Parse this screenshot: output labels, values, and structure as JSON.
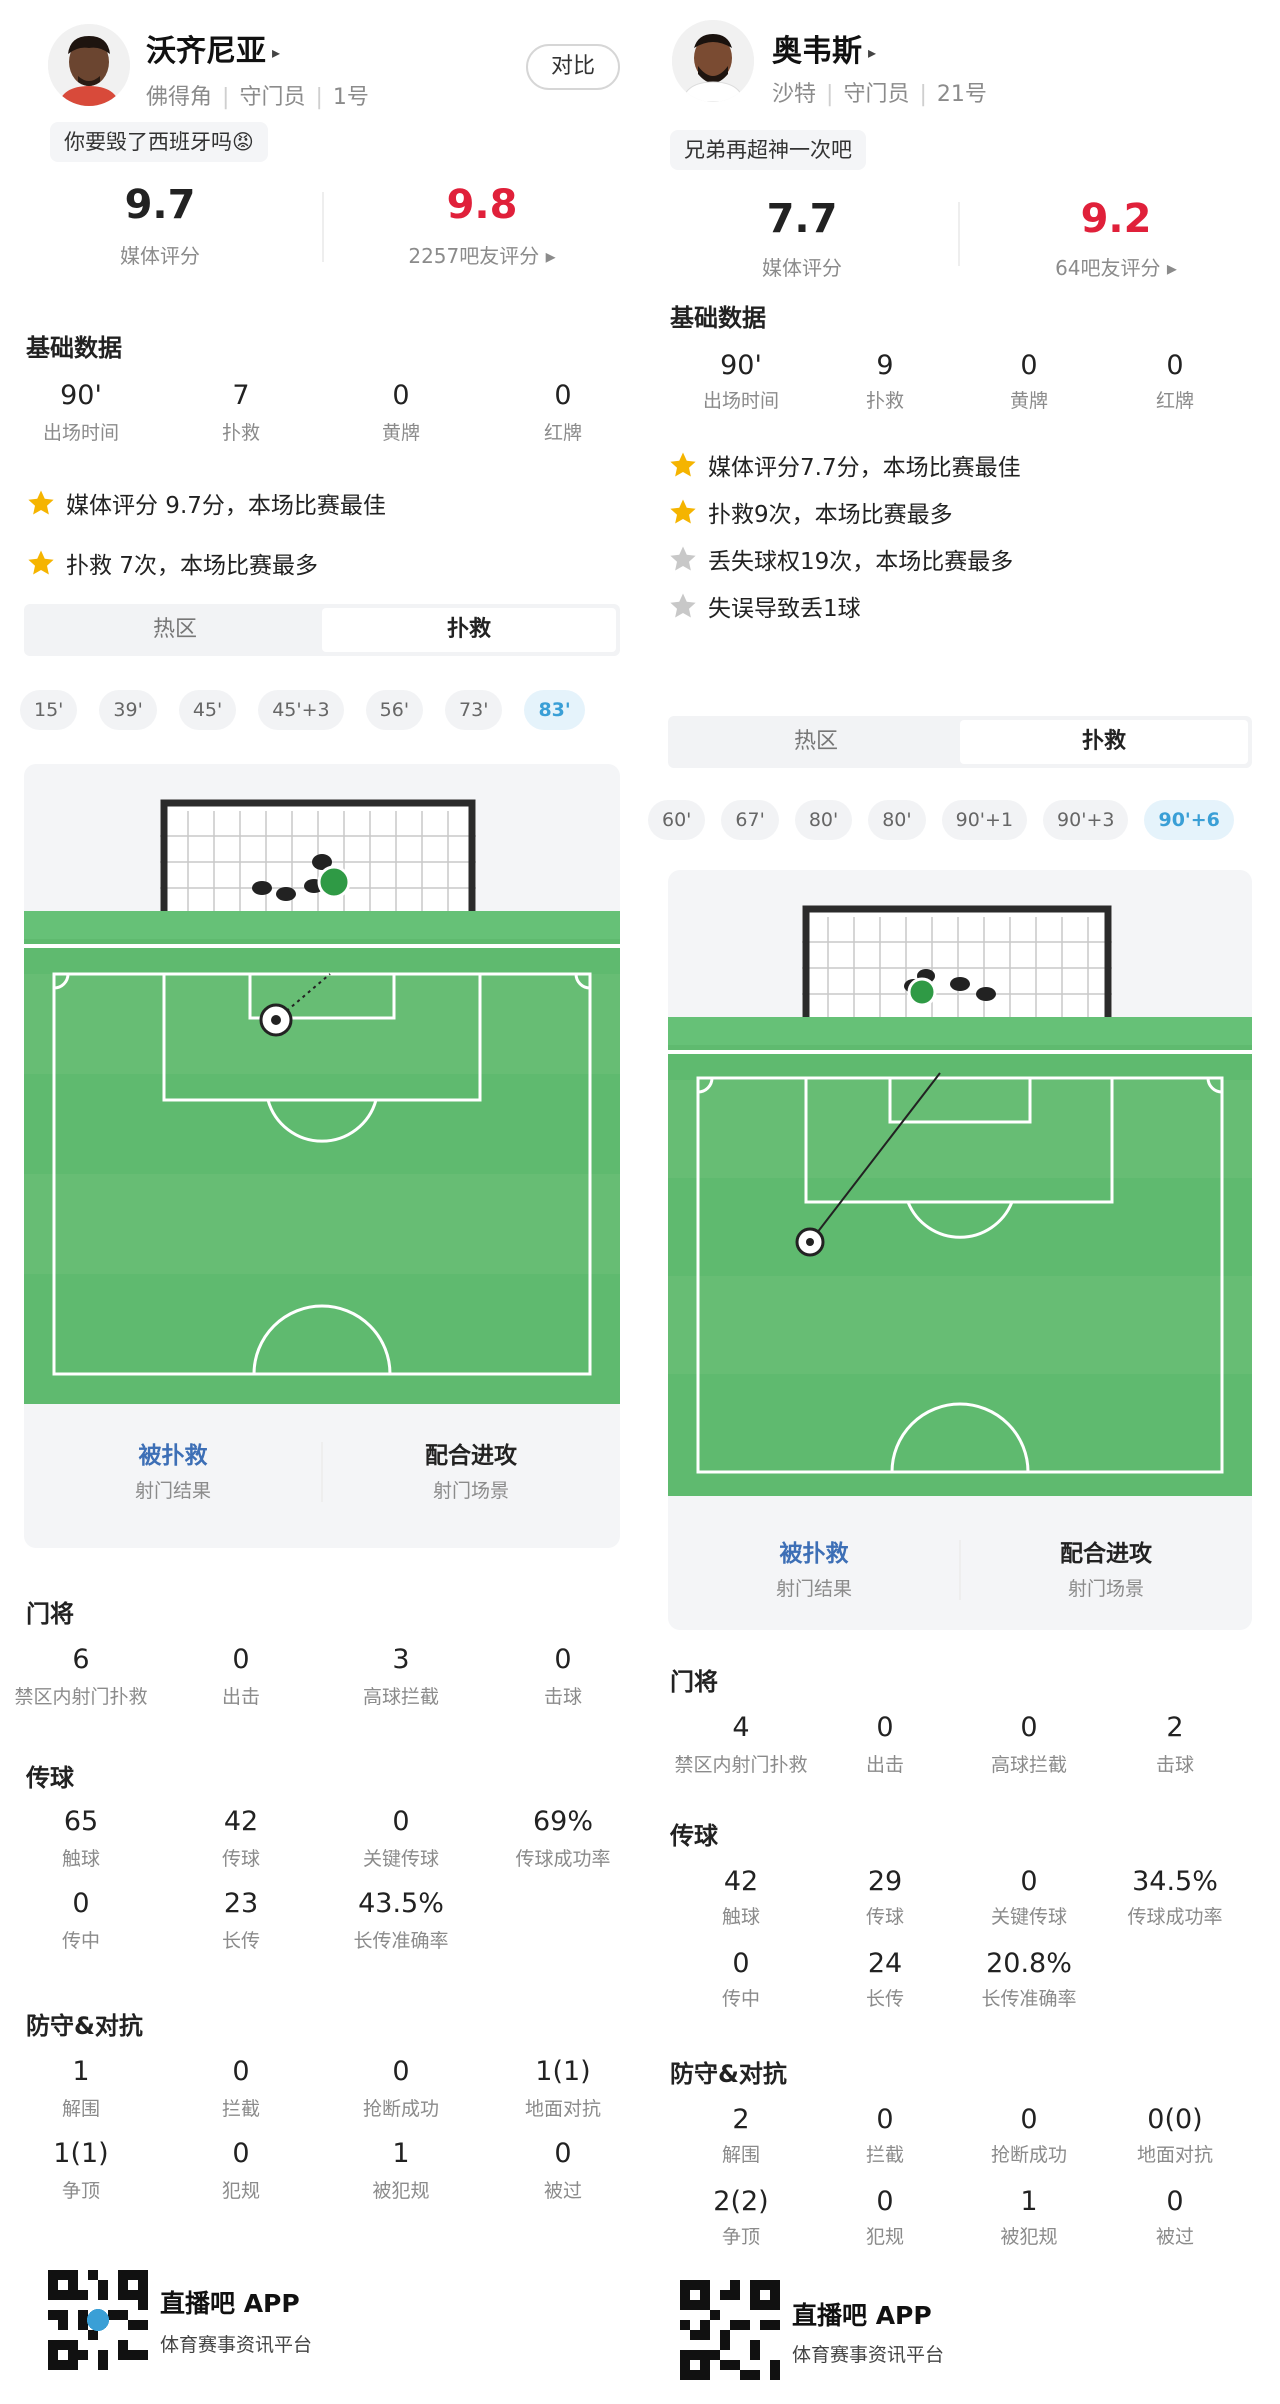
{
  "colors": {
    "rating_fan": "#e0203a",
    "accent_blue": "#3a9fd6",
    "result_blue": "#3d6fb6",
    "pitch_green": "#5fba6f",
    "star_gold": "#f5b400",
    "star_grey": "#c8c8c8"
  },
  "left": {
    "player": {
      "name": "沃齐尼亚",
      "team": "佛得角",
      "position": "守门员",
      "number": "1号",
      "quote": "你要毁了西班牙吗😡",
      "compare_label": "对比"
    },
    "ratings": {
      "media_value": "9.7",
      "media_label": "媒体评分",
      "fan_value": "9.8",
      "fan_label": "2257吧友评分 ▸"
    },
    "basic": {
      "title": "基础数据",
      "items": [
        {
          "value": "90'",
          "label": "出场时间"
        },
        {
          "value": "7",
          "label": "扑救"
        },
        {
          "value": "0",
          "label": "黄牌"
        },
        {
          "value": "0",
          "label": "红牌"
        }
      ]
    },
    "highlights": [
      {
        "text": "媒体评分 9.7分，本场比赛最佳",
        "icon": "star-gold-icon"
      },
      {
        "text": "扑救 7次，本场比赛最多",
        "icon": "star-gold-icon"
      }
    ],
    "tabs": [
      "热区",
      "扑救"
    ],
    "active_tab": 1,
    "chips": [
      "15'",
      "39'",
      "45'",
      "45'+3",
      "56'",
      "73'",
      "83'"
    ],
    "active_chip": 6,
    "shot": {
      "result_value": "被扑救",
      "result_label": "射门结果",
      "scene_value": "配合进攻",
      "scene_label": "射门场景"
    },
    "gk": {
      "title": "门将",
      "items": [
        {
          "value": "6",
          "label": "禁区内射门扑救"
        },
        {
          "value": "0",
          "label": "出击"
        },
        {
          "value": "3",
          "label": "高球拦截"
        },
        {
          "value": "0",
          "label": "击球"
        }
      ]
    },
    "passing": {
      "title": "传球",
      "row1": [
        {
          "value": "65",
          "label": "触球"
        },
        {
          "value": "42",
          "label": "传球"
        },
        {
          "value": "0",
          "label": "关键传球"
        },
        {
          "value": "69%",
          "label": "传球成功率"
        }
      ],
      "row2": [
        {
          "value": "0",
          "label": "传中"
        },
        {
          "value": "23",
          "label": "长传"
        },
        {
          "value": "43.5%",
          "label": "长传准确率"
        }
      ]
    },
    "defense": {
      "title": "防守&对抗",
      "row1": [
        {
          "value": "1",
          "label": "解围"
        },
        {
          "value": "0",
          "label": "拦截"
        },
        {
          "value": "0",
          "label": "抢断成功"
        },
        {
          "value": "1(1)",
          "label": "地面对抗"
        }
      ],
      "row2": [
        {
          "value": "1(1)",
          "label": "争顶"
        },
        {
          "value": "0",
          "label": "犯规"
        },
        {
          "value": "1",
          "label": "被犯规"
        },
        {
          "value": "0",
          "label": "被过"
        }
      ]
    },
    "footer": {
      "app_name": "直播吧 APP",
      "app_sub": "体育赛事资讯平台"
    }
  },
  "right": {
    "player": {
      "name": "奥韦斯",
      "team": "沙特",
      "position": "守门员",
      "number": "21号",
      "quote": "兄弟再超神一次吧"
    },
    "ratings": {
      "media_value": "7.7",
      "media_label": "媒体评分",
      "fan_value": "9.2",
      "fan_label": "64吧友评分 ▸"
    },
    "basic": {
      "title": "基础数据",
      "items": [
        {
          "value": "90'",
          "label": "出场时间"
        },
        {
          "value": "9",
          "label": "扑救"
        },
        {
          "value": "0",
          "label": "黄牌"
        },
        {
          "value": "0",
          "label": "红牌"
        }
      ]
    },
    "highlights": [
      {
        "text": "媒体评分7.7分，本场比赛最佳",
        "icon": "star-gold-icon"
      },
      {
        "text": "扑救9次，本场比赛最多",
        "icon": "star-gold-icon"
      },
      {
        "text": "丢失球权19次，本场比赛最多",
        "icon": "star-grey-icon"
      },
      {
        "text": "失误导致丢1球",
        "icon": "star-grey-icon"
      }
    ],
    "tabs": [
      "热区",
      "扑救"
    ],
    "active_tab": 1,
    "chips": [
      "60'",
      "67'",
      "80'",
      "80'",
      "90'+1",
      "90'+3",
      "90'+6"
    ],
    "active_chip": 6,
    "shot": {
      "result_value": "被扑救",
      "result_label": "射门结果",
      "scene_value": "配合进攻",
      "scene_label": "射门场景"
    },
    "gk": {
      "title": "门将",
      "items": [
        {
          "value": "4",
          "label": "禁区内射门扑救"
        },
        {
          "value": "0",
          "label": "出击"
        },
        {
          "value": "0",
          "label": "高球拦截"
        },
        {
          "value": "2",
          "label": "击球"
        }
      ]
    },
    "passing": {
      "title": "传球",
      "row1": [
        {
          "value": "42",
          "label": "触球"
        },
        {
          "value": "29",
          "label": "传球"
        },
        {
          "value": "0",
          "label": "关键传球"
        },
        {
          "value": "34.5%",
          "label": "传球成功率"
        }
      ],
      "row2": [
        {
          "value": "0",
          "label": "传中"
        },
        {
          "value": "24",
          "label": "长传"
        },
        {
          "value": "20.8%",
          "label": "长传准确率"
        }
      ]
    },
    "defense": {
      "title": "防守&对抗",
      "row1": [
        {
          "value": "2",
          "label": "解围"
        },
        {
          "value": "0",
          "label": "拦截"
        },
        {
          "value": "0",
          "label": "抢断成功"
        },
        {
          "value": "0(0)",
          "label": "地面对抗"
        }
      ],
      "row2": [
        {
          "value": "2(2)",
          "label": "争顶"
        },
        {
          "value": "0",
          "label": "犯规"
        },
        {
          "value": "1",
          "label": "被犯规"
        },
        {
          "value": "0",
          "label": "被过"
        }
      ]
    },
    "footer": {
      "app_name": "直播吧 APP",
      "app_sub": "体育赛事资讯平台"
    }
  }
}
